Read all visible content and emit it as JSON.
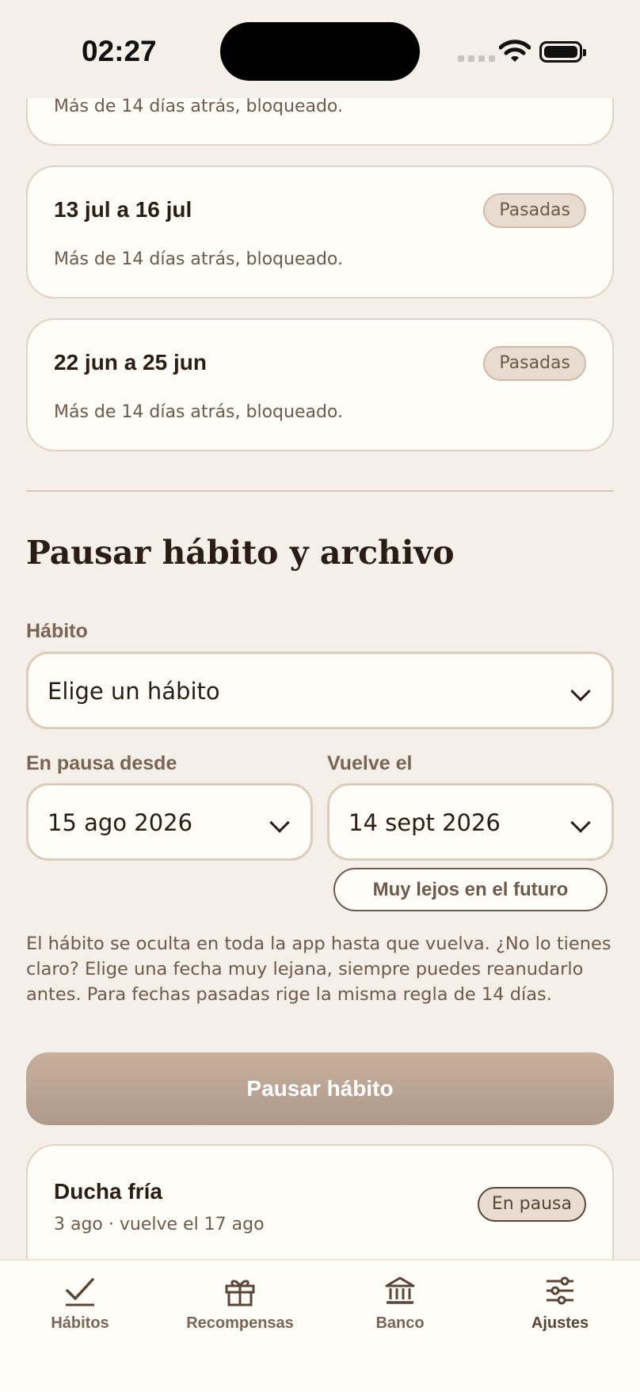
{
  "status_bar": {
    "time": "02:27"
  },
  "cards": [
    {
      "range": "",
      "subtitle": "Más de 14 días atrás, bloqueado.",
      "badge": ""
    },
    {
      "range": "13 jul a 16 jul",
      "subtitle": "Más de 14 días atrás, bloqueado.",
      "badge": "Pasadas"
    },
    {
      "range": "22 jun a 25 jun",
      "subtitle": "Más de 14 días atrás, bloqueado.",
      "badge": "Pasadas"
    }
  ],
  "pause_section": {
    "title": "Pausar hábito y archivo",
    "habit_label": "Hábito",
    "habit_placeholder": "Elige un hábito",
    "from_label": "En pausa desde",
    "from_value": "15 ago 2026",
    "return_label": "Vuelve el",
    "return_value": "14 sept 2026",
    "far_future_button": "Muy lejos en el futuro",
    "help_text": "El hábito se oculta en toda la app hasta que vuelva. ¿No lo tienes claro? Elige una fecha muy lejana, siempre puedes reanudarlo antes. Para fechas pasadas rige la misma regla de 14 días.",
    "submit_button": "Pausar hábito"
  },
  "paused_habit": {
    "name": "Ducha fría",
    "detail": "3 ago · vuelve el 17 ago",
    "badge": "En pausa"
  },
  "tab_bar": {
    "items": [
      {
        "label": "Hábitos",
        "icon": "check-icon"
      },
      {
        "label": "Recompensas",
        "icon": "gift-icon"
      },
      {
        "label": "Banco",
        "icon": "bank-icon"
      },
      {
        "label": "Ajustes",
        "icon": "sliders-icon",
        "active": true
      }
    ]
  },
  "colors": {
    "background": "#f4efe8",
    "card": "#fffdf8",
    "accent": "#6e5a4b",
    "button": "#c8b09c"
  }
}
